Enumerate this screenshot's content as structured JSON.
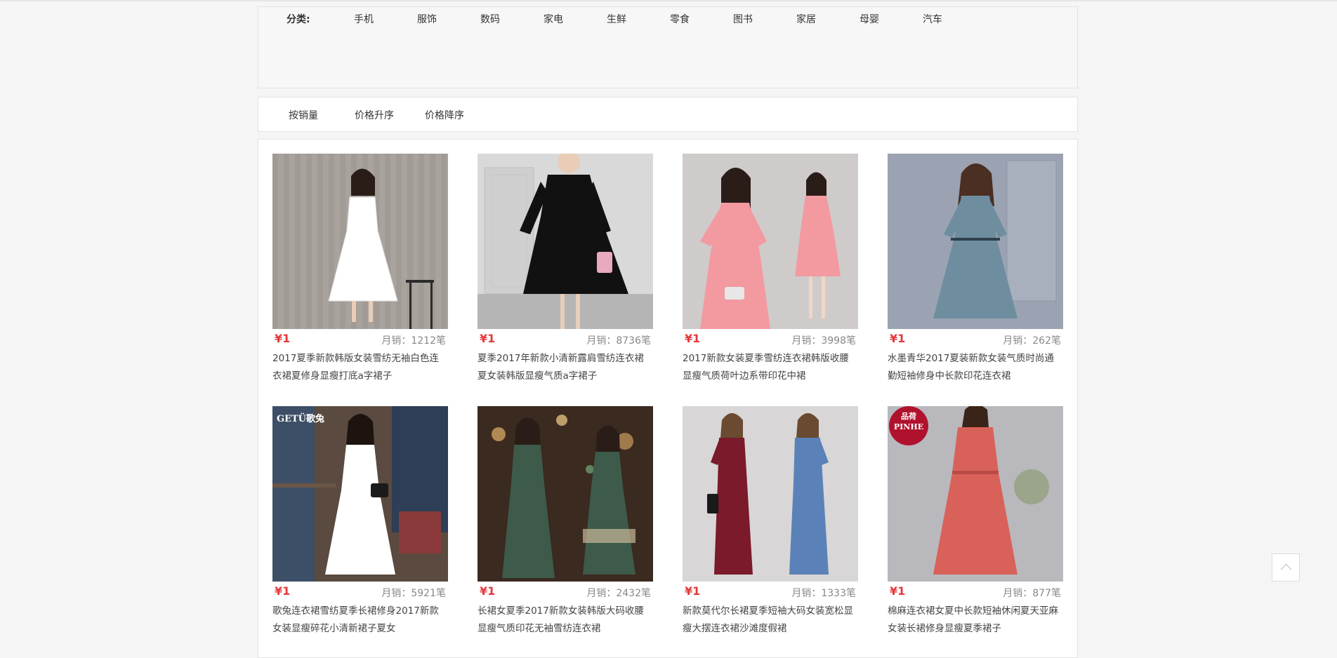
{
  "categories": {
    "label": "分类:",
    "items": [
      "手机",
      "服饰",
      "数码",
      "家电",
      "生鲜",
      "零食",
      "图书",
      "家居",
      "母婴",
      "汽车"
    ]
  },
  "sort": {
    "items": [
      "按销量",
      "价格升序",
      "价格降序"
    ]
  },
  "products": [
    {
      "price": "¥1",
      "sales": "月销：1212笔",
      "title": "2017夏季新款韩版女装雪纺无袖白色连衣裙夏修身显瘦打底a字裙子",
      "dress_color": "#ffffff",
      "bg_color": "#a9a39d"
    },
    {
      "price": "¥1",
      "sales": "月销：8736笔",
      "title": "夏季2017年新款小清新露肩雪纺连衣裙夏女装韩版显瘦气质a字裙子",
      "dress_color": "#111111",
      "bg_color": "#d9d9d9"
    },
    {
      "price": "¥1",
      "sales": "月销：3998笔",
      "title": "2017新款女装夏季雪纺连衣裙韩版收腰显瘦气质荷叶边系带印花中裙",
      "dress_color": "#f29aa0",
      "bg_color": "#cfcbcb"
    },
    {
      "price": "¥1",
      "sales": "月销：262笔",
      "title": "水墨青华2017夏装新款女装气质时尚通勤短袖修身中长款印花连衣裙",
      "dress_color": "#6e8ea0",
      "bg_color": "#9ba3b2"
    },
    {
      "price": "¥1",
      "sales": "月销：5921笔",
      "title": "歌兔连衣裙雪纺夏季长裙修身2017新款女装显瘦碎花小清新裙子夏女",
      "dress_color": "#ffffff",
      "bg_color": "#5a4a3f",
      "badge": "GETÜ歌兔"
    },
    {
      "price": "¥1",
      "sales": "月销：2432笔",
      "title": "长裙女夏季2017新款女装韩版大码收腰显瘦气质印花无袖雪纺连衣裙",
      "dress_color": "#3d5a4a",
      "bg_color": "#3a2a20"
    },
    {
      "price": "¥1",
      "sales": "月销：1333笔",
      "title": "新款莫代尔长裙夏季短袖大码女装宽松显瘦大摆连衣裙沙滩度假裙",
      "dress_color": "#7a1a2a",
      "dress_color2": "#5a82b8",
      "bg_color": "#d8d6d6"
    },
    {
      "price": "¥1",
      "sales": "月销：877笔",
      "title": "棉麻连衣裙女夏中长款短袖休闲夏天亚麻女装长裙修身显瘦夏季裙子",
      "dress_color": "#d8615a",
      "bg_color": "#b9b8bd",
      "badge": "品荷 PINHE"
    }
  ],
  "back_to_top_icon": "chevron-up-icon"
}
